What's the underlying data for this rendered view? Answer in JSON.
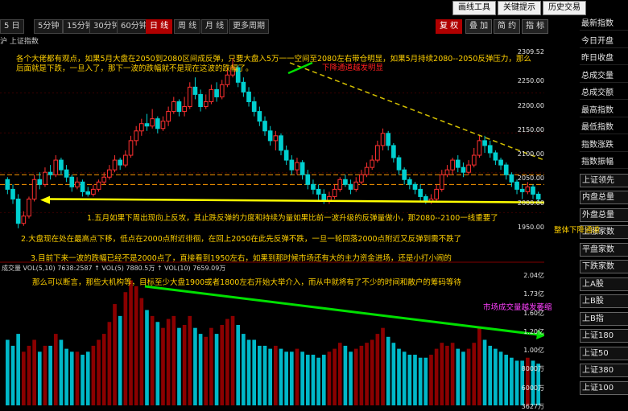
{
  "toolbar": {
    "periods": [
      "5 日",
      "5分钟",
      "15分钟",
      "30分钟",
      "60分钟",
      "日 线",
      "周 线",
      "月 线",
      "更多周期"
    ],
    "active_period": "日 线",
    "right_buttons": [
      "复 权",
      "叠 加",
      "简 约",
      "指 标"
    ],
    "top_buttons": [
      "画线工具",
      "关键提示",
      "历史交易"
    ]
  },
  "security_line": "沪 上证指数",
  "price_axis_labels": [
    "2309.52",
    "2250.00",
    "2200.00",
    "2150.00",
    "2100.00",
    "2050.00",
    "2000.00",
    "1950.00"
  ],
  "volume_axis_labels": [
    "2.04亿",
    "1.73亿",
    "1.60亿",
    "1.20亿",
    "1.00亿",
    "8000万",
    "6000万",
    "3627万"
  ],
  "price_tag_current": "2000.00",
  "annotations": {
    "a1": "各个大佬都有观点，如果5月大盘在2050到2080区间成反弹，只要大盘入5万一一空间至2080左右带仓明显，如果5月持续2080--2050反弹压力，那么后面就是下跌，一旦入了，那下一波的跌幅就不是现在这波的跌幅了。",
    "a2": "下降通道越发明显",
    "a3": "1.五月如果下周出现向上反攻，其止跌反弹的力度和持续为量如果比前一波升级的反弹量做小，那2080--2100一线重要了",
    "a4": "2.大盘现在处在最高点下移，低点在2000点附近徘徊，在回上2050在此先反弹不跌，一旦一轮回落2000点附近又反弹到需不跌了",
    "a5": "3.目前下来一波的跌幅已经不是2000点了，直接看到1950左右，如果到那时候市场还有大的主力资金进场，还是小打小闹的",
    "a6": "那么可以断言，那些大机构等，目标至少大盘1900或者1800左右开始大举介入，而从中就将有了不少的时间和散户的筹码等待",
    "a7": "整体下降通道",
    "a8": "市场成交量越发萎缩"
  },
  "volume_header": "成交量 VOL(5,10) 7638:2587 ↑ VOL(5) 7880.5万 ↑ VOL(10) 7659.09万",
  "side_menu": [
    "最新指数",
    "今日开盘",
    "昨日收盘",
    "总成交量",
    "总成交额",
    "最高指数",
    "最低指数",
    "指数涨跌",
    "指数振幅",
    "上证领先",
    "内盘总量",
    "外盘总量",
    "上涨家数",
    "平盘家数",
    "下跌家数",
    "上A股",
    "上B股",
    "上B指",
    "上证180",
    "上证50",
    "上证380",
    "上证100"
  ],
  "colors": {
    "up": "#ff3030",
    "down": "#00d0d0",
    "accent": "#ffff00",
    "green": "#00c800",
    "magenta": "#ff00ff",
    "orange": "#ff9900"
  },
  "chart_data": {
    "type": "candlestick",
    "ylim": [
      1900,
      2310
    ],
    "candles": [
      [
        2050,
        2030,
        2055,
        2020
      ],
      [
        2030,
        2010,
        2040,
        2000
      ],
      [
        2010,
        1960,
        2020,
        1950
      ],
      [
        1960,
        1975,
        1985,
        1955
      ],
      [
        1975,
        2010,
        2015,
        1970
      ],
      [
        2010,
        2050,
        2060,
        2005
      ],
      [
        2050,
        2040,
        2065,
        2030
      ],
      [
        2040,
        2065,
        2075,
        2035
      ],
      [
        2065,
        2060,
        2080,
        2050
      ],
      [
        2060,
        2090,
        2100,
        2055
      ],
      [
        2090,
        2070,
        2095,
        2060
      ],
      [
        2070,
        2055,
        2080,
        2045
      ],
      [
        2055,
        2035,
        2060,
        2025
      ],
      [
        2035,
        2045,
        2055,
        2030
      ],
      [
        2045,
        2025,
        2050,
        2015
      ],
      [
        2025,
        2020,
        2035,
        2015
      ],
      [
        2020,
        2030,
        2040,
        2015
      ],
      [
        2030,
        2045,
        2050,
        2025
      ],
      [
        2045,
        2055,
        2065,
        2040
      ],
      [
        2055,
        2070,
        2080,
        2050
      ],
      [
        2070,
        2090,
        2100,
        2065
      ],
      [
        2090,
        2080,
        2095,
        2070
      ],
      [
        2080,
        2100,
        2110,
        2075
      ],
      [
        2100,
        2130,
        2140,
        2095
      ],
      [
        2130,
        2150,
        2160,
        2120
      ],
      [
        2150,
        2165,
        2175,
        2140
      ],
      [
        2165,
        2160,
        2185,
        2150
      ],
      [
        2160,
        2175,
        2195,
        2155
      ],
      [
        2175,
        2155,
        2180,
        2145
      ],
      [
        2155,
        2170,
        2180,
        2150
      ],
      [
        2170,
        2190,
        2200,
        2160
      ],
      [
        2190,
        2210,
        2220,
        2185
      ],
      [
        2210,
        2190,
        2215,
        2180
      ],
      [
        2190,
        2200,
        2220,
        2180
      ],
      [
        2200,
        2240,
        2250,
        2195
      ],
      [
        2240,
        2225,
        2260,
        2215
      ],
      [
        2225,
        2200,
        2235,
        2190
      ],
      [
        2200,
        2210,
        2225,
        2195
      ],
      [
        2210,
        2235,
        2245,
        2205
      ],
      [
        2235,
        2220,
        2250,
        2210
      ],
      [
        2220,
        2245,
        2255,
        2215
      ],
      [
        2245,
        2265,
        2280,
        2240
      ],
      [
        2265,
        2280,
        2300,
        2260
      ],
      [
        2280,
        2250,
        2285,
        2240
      ],
      [
        2250,
        2230,
        2260,
        2220
      ],
      [
        2230,
        2210,
        2240,
        2200
      ],
      [
        2210,
        2190,
        2220,
        2180
      ],
      [
        2190,
        2170,
        2200,
        2160
      ],
      [
        2170,
        2150,
        2180,
        2140
      ],
      [
        2150,
        2130,
        2160,
        2120
      ],
      [
        2130,
        2140,
        2150,
        2110
      ],
      [
        2140,
        2110,
        2145,
        2100
      ],
      [
        2110,
        2090,
        2120,
        2080
      ],
      [
        2090,
        2070,
        2100,
        2060
      ],
      [
        2070,
        2085,
        2095,
        2060
      ],
      [
        2085,
        2060,
        2090,
        2050
      ],
      [
        2060,
        2040,
        2070,
        2030
      ],
      [
        2040,
        2030,
        2050,
        2020
      ],
      [
        2030,
        2020,
        2040,
        2005
      ],
      [
        2020,
        2005,
        2030,
        2000
      ],
      [
        2005,
        2015,
        2025,
        2000
      ],
      [
        2015,
        2030,
        2040,
        2010
      ],
      [
        2030,
        2050,
        2055,
        2025
      ],
      [
        2050,
        2040,
        2060,
        2035
      ],
      [
        2040,
        2030,
        2050,
        2020
      ],
      [
        2030,
        2045,
        2055,
        2025
      ],
      [
        2045,
        2060,
        2070,
        2040
      ],
      [
        2060,
        2075,
        2085,
        2055
      ],
      [
        2075,
        2090,
        2100,
        2070
      ],
      [
        2090,
        2120,
        2130,
        2085
      ],
      [
        2120,
        2145,
        2155,
        2110
      ],
      [
        2145,
        2120,
        2150,
        2110
      ],
      [
        2120,
        2095,
        2125,
        2085
      ],
      [
        2095,
        2070,
        2100,
        2060
      ],
      [
        2070,
        2050,
        2075,
        2040
      ],
      [
        2050,
        2040,
        2055,
        2030
      ],
      [
        2040,
        2030,
        2045,
        2020
      ],
      [
        2030,
        2015,
        2040,
        2005
      ],
      [
        2015,
        2005,
        2020,
        2000
      ],
      [
        2005,
        2010,
        2020,
        2000
      ],
      [
        2010,
        2030,
        2040,
        2005
      ],
      [
        2030,
        2060,
        2070,
        2025
      ],
      [
        2060,
        2070,
        2080,
        2055
      ],
      [
        2070,
        2090,
        2095,
        2060
      ],
      [
        2090,
        2075,
        2100,
        2065
      ],
      [
        2075,
        2065,
        2085,
        2055
      ],
      [
        2065,
        2080,
        2090,
        2060
      ],
      [
        2080,
        2100,
        2115,
        2075
      ],
      [
        2100,
        2130,
        2140,
        2095
      ],
      [
        2130,
        2120,
        2140,
        2105
      ],
      [
        2120,
        2105,
        2130,
        2095
      ],
      [
        2105,
        2090,
        2110,
        2080
      ],
      [
        2090,
        2080,
        2095,
        2070
      ],
      [
        2080,
        2060,
        2085,
        2050
      ],
      [
        2060,
        2045,
        2065,
        2035
      ],
      [
        2045,
        2030,
        2050,
        2020
      ],
      [
        2030,
        2025,
        2040,
        2010
      ],
      [
        2025,
        2035,
        2045,
        2020
      ],
      [
        2035,
        2020,
        2040,
        2010
      ],
      [
        2020,
        2010,
        2025,
        2005
      ]
    ],
    "volumes": [
      1.1,
      1.0,
      1.2,
      0.9,
      1.0,
      1.1,
      0.9,
      1.0,
      1.0,
      1.2,
      1.1,
      0.95,
      0.9,
      0.9,
      0.85,
      0.9,
      1.0,
      1.1,
      1.2,
      1.4,
      1.7,
      1.5,
      1.9,
      2.1,
      2.0,
      1.8,
      1.6,
      1.5,
      1.4,
      1.3,
      1.45,
      1.5,
      1.3,
      1.35,
      1.5,
      1.3,
      1.2,
      1.15,
      1.3,
      1.2,
      1.35,
      1.45,
      1.5,
      1.35,
      1.2,
      1.1,
      1.1,
      1.0,
      1.0,
      0.95,
      1.0,
      0.95,
      0.9,
      0.9,
      0.95,
      0.9,
      0.85,
      0.85,
      0.8,
      0.85,
      0.9,
      0.95,
      1.05,
      1.0,
      0.9,
      0.95,
      1.0,
      1.05,
      1.1,
      1.2,
      1.3,
      1.15,
      1.05,
      0.95,
      0.9,
      0.85,
      0.85,
      0.8,
      0.8,
      0.85,
      0.95,
      1.05,
      1.0,
      1.05,
      0.95,
      0.9,
      0.95,
      1.05,
      1.3,
      1.1,
      1.0,
      0.95,
      0.9,
      0.85,
      0.8,
      0.75,
      0.75,
      0.8,
      0.75,
      0.7
    ]
  }
}
